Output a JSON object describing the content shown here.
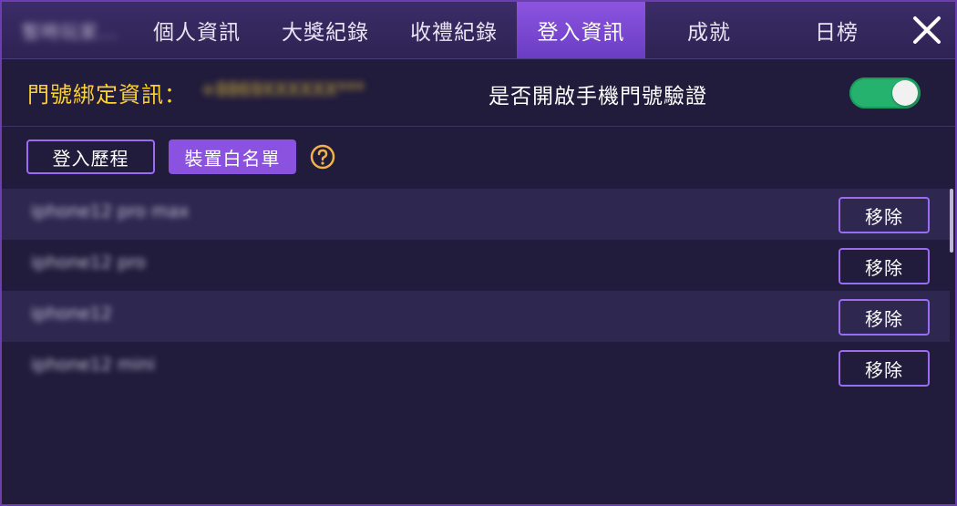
{
  "tabs": [
    {
      "label": "暫時玩家...",
      "blurred": true
    },
    {
      "label": "個人資訊"
    },
    {
      "label": "大獎紀錄"
    },
    {
      "label": "收禮紀錄"
    },
    {
      "label": "登入資訊",
      "active": true
    },
    {
      "label": "成就"
    },
    {
      "label": "日榜"
    }
  ],
  "header": {
    "bind_label": "門號綁定資訊：",
    "bind_value": "+8869XXXXXX***",
    "verify_label": "是否開啟手機門號驗證",
    "verify_enabled": true
  },
  "subtabs": {
    "login_history": "登入歷程",
    "device_whitelist": "裝置白名單"
  },
  "devices": [
    {
      "name": "iphone12 pro max",
      "remove_label": "移除"
    },
    {
      "name": "iphone12 pro",
      "remove_label": "移除"
    },
    {
      "name": "iphone12",
      "remove_label": "移除"
    },
    {
      "name": "iphone12 mini",
      "remove_label": "移除"
    }
  ],
  "colors": {
    "accent": "#8a52de",
    "highlight": "#ffd12e",
    "toggle_on": "#25b26e",
    "background": "#211b3c"
  },
  "icons": {
    "close": "close-icon",
    "help": "question-circle-icon"
  }
}
